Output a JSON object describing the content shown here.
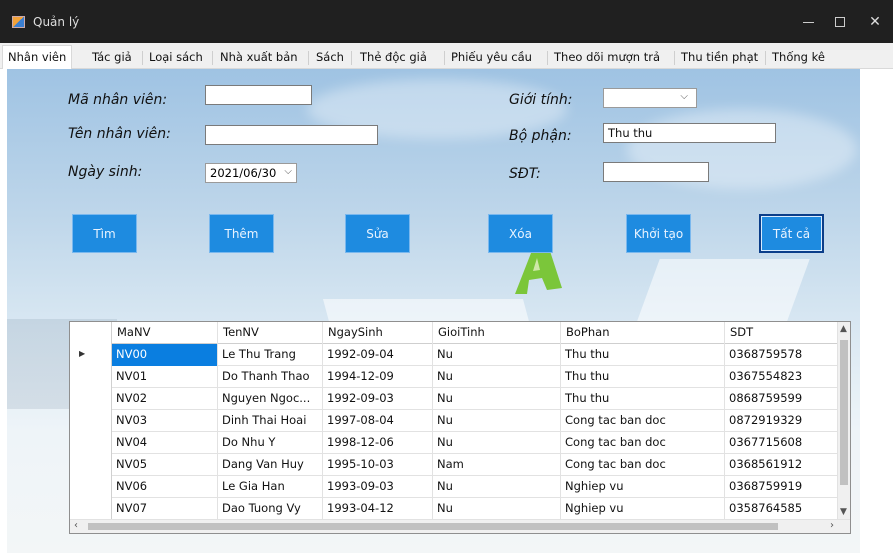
{
  "window": {
    "title": "Quản lý",
    "minimize": "—",
    "close": "✕"
  },
  "tabs": [
    "Nhân viên",
    "Tác giả",
    "Loại sách",
    "Nhà xuất bản",
    "Sách",
    "Thẻ độc giả",
    "Phiếu yêu cầu",
    "Theo dõi mượn trả",
    "Thu tiền phạt",
    "Thống kê"
  ],
  "form": {
    "ma_nv_label": "Mã nhân viên:",
    "ma_nv_value": "",
    "ten_nv_label": "Tên nhân viên:",
    "ten_nv_value": "",
    "ngay_sinh_label": "Ngày sinh:",
    "ngay_sinh_value": "2021/06/30",
    "gioi_tinh_label": "Giới tính:",
    "gioi_tinh_value": "",
    "bo_phan_label": "Bộ phận:",
    "bo_phan_value": "Thu thu",
    "sdt_label": "SĐT:",
    "sdt_value": ""
  },
  "buttons": {
    "tim": "Tìm",
    "them": "Thêm",
    "sua": "Sửa",
    "xoa": "Xóa",
    "khoi_tao": "Khởi tạo",
    "tat_ca": "Tất cả"
  },
  "grid": {
    "columns": [
      "MaNV",
      "TenNV",
      "NgaySinh",
      "GioiTinh",
      "BoPhan",
      "SDT"
    ],
    "rows": [
      [
        "NV00",
        "Le Thu Trang",
        "1992-09-04",
        "Nu",
        "Thu thu",
        "0368759578"
      ],
      [
        "NV01",
        "Do Thanh Thao",
        "1994-12-09",
        "Nu",
        "Thu thu",
        "0367554823"
      ],
      [
        "NV02",
        "Nguyen Ngoc...",
        "1992-09-03",
        "Nu",
        "Thu thu",
        "0868759599"
      ],
      [
        "NV03",
        "Dinh Thai Hoai",
        "1997-08-04",
        "Nu",
        "Cong tac ban doc",
        "0872919329"
      ],
      [
        "NV04",
        "Do Nhu Y",
        "1998-12-06",
        "Nu",
        "Cong tac ban doc",
        "0367715608"
      ],
      [
        "NV05",
        "Dang Van Huy",
        "1995-10-03",
        "Nam",
        "Cong tac ban doc",
        "0368561912"
      ],
      [
        "NV06",
        "Le Gia Han",
        "1993-09-03",
        "Nu",
        "Nghiep vu",
        "0368759919"
      ],
      [
        "NV07",
        "Dao Tuong Vy",
        "1993-04-12",
        "Nu",
        "Nghiep vu",
        "0358764585"
      ]
    ]
  },
  "colors": {
    "button": "#1e8be0",
    "selected_cell": "#0a7ee0",
    "titlebar": "#202020"
  }
}
